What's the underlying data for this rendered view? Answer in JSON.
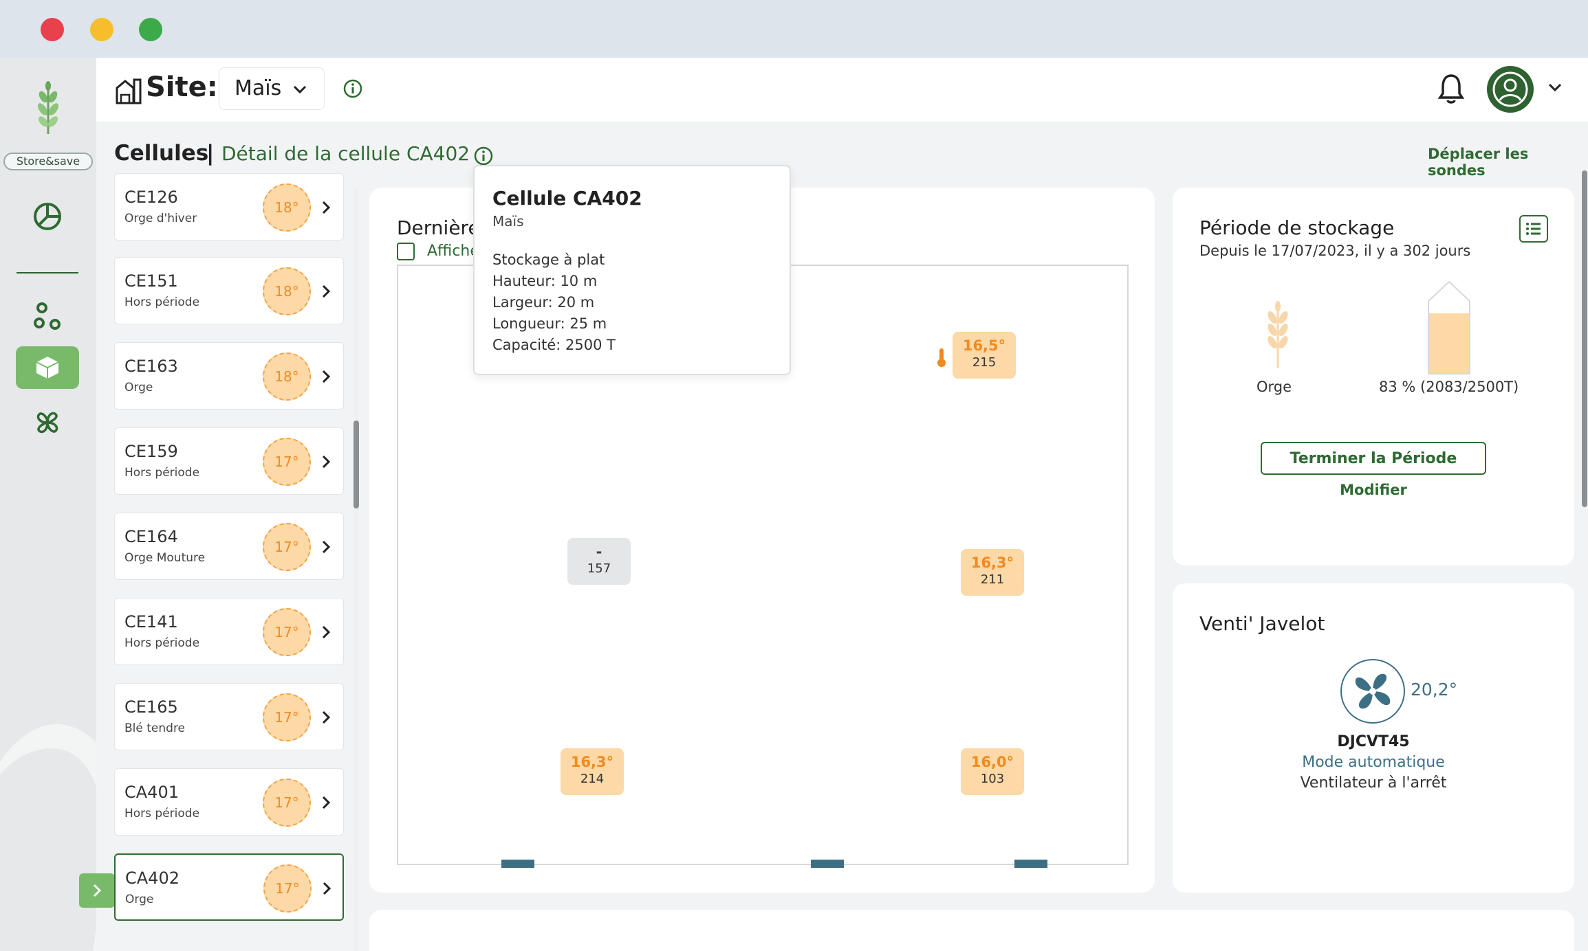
{
  "header": {
    "site_label": "Site:",
    "site_value": "Maïs"
  },
  "breadcrumb": {
    "section": "Cellules",
    "separator": "|",
    "detail": "Détail de la cellule CA402",
    "move_probes": "Déplacer les sondes"
  },
  "sidebar": {
    "logo_text": "Store&save",
    "items": [
      "dashboard-icon",
      "network-icon",
      "cell-box-icon",
      "ventilation-icon"
    ]
  },
  "cells": [
    {
      "name": "CE126",
      "sub": "Orge d'hiver",
      "temp": "18°"
    },
    {
      "name": "CE151",
      "sub": "Hors période",
      "temp": "18°"
    },
    {
      "name": "CE163",
      "sub": "Orge",
      "temp": "18°"
    },
    {
      "name": "CE159",
      "sub": "Hors période",
      "temp": "17°"
    },
    {
      "name": "CE164",
      "sub": "Orge Mouture",
      "temp": "17°"
    },
    {
      "name": "CE141",
      "sub": "Hors période",
      "temp": "17°"
    },
    {
      "name": "CE165",
      "sub": "Blé tendre",
      "temp": "17°"
    },
    {
      "name": "CA401",
      "sub": "Hors période",
      "temp": "17°"
    },
    {
      "name": "CA402",
      "sub": "Orge",
      "temp": "17°"
    }
  ],
  "main": {
    "title": "Dernière",
    "checkbox_label": "Affiche",
    "probes": [
      {
        "temp": "16,5°",
        "id": "215"
      },
      {
        "temp": "-",
        "id": "157"
      },
      {
        "temp": "16,3°",
        "id": "211"
      },
      {
        "temp": "16,3°",
        "id": "214"
      },
      {
        "temp": "16,0°",
        "id": "103"
      }
    ]
  },
  "tooltip": {
    "title": "Cellule CA402",
    "subtitle": "Maïs",
    "storage": "Stockage à plat",
    "height": "Hauteur: 10 m",
    "width": "Largeur: 20 m",
    "length": "Longueur: 25 m",
    "capacity": "Capacité: 2500 T"
  },
  "period": {
    "title": "Période de stockage",
    "since": "Depuis le 17/07/2023, il y a 302 jours",
    "grain": "Orge",
    "fill_text": "83 % (2083/2500T)",
    "fill_fraction": 0.83,
    "end_button": "Terminer la Période",
    "modify": "Modifier"
  },
  "vent": {
    "title": "Venti' Javelot",
    "temp": "20,2°",
    "name": "DJCVT45",
    "mode": "Mode automatique",
    "status": "Ventilateur à l'arrêt"
  },
  "colors": {
    "primary_green": "#2e6a31",
    "accent_green": "#78b96a",
    "temp_orange": "#ef8a22",
    "temp_fill": "#fcd9a7",
    "fan_blue": "#3d6f84"
  }
}
